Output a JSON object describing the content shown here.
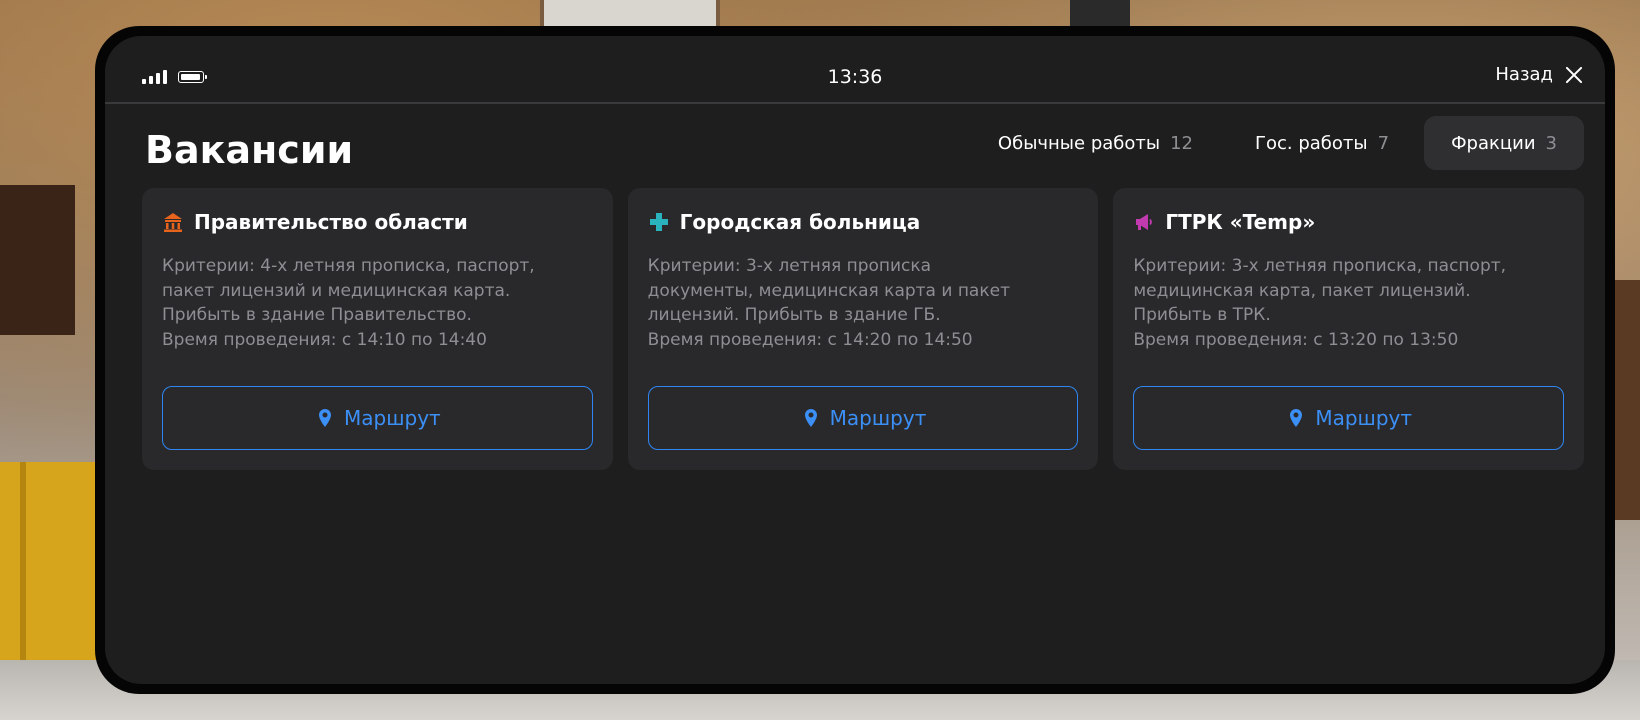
{
  "statusbar": {
    "time": "13:36",
    "back_label": "Назад"
  },
  "page": {
    "title": "Вакансии"
  },
  "tabs": [
    {
      "label": "Обычные работы",
      "count": "12",
      "active": false
    },
    {
      "label": "Гос. работы",
      "count": "7",
      "active": false
    },
    {
      "label": "Фракции",
      "count": "3",
      "active": true
    }
  ],
  "cards": [
    {
      "icon": "government-building-icon",
      "icon_color": "#e8631c",
      "title": "Правительство области",
      "lines": [
        "Критерии: 4-х летняя прописка, паспорт,",
        "пакет лицензий и медицинская карта.",
        "Прибыть в здание Правительство.",
        "Время проведения: с 14:10 по 14:40"
      ],
      "button_label": "Маршрут"
    },
    {
      "icon": "medical-cross-icon",
      "icon_color": "#2bb3bd",
      "title": "Городская больница",
      "lines": [
        "Критерии: 3-х летняя прописка",
        "документы, медицинская карта и пакет",
        "лицензий. Прибыть в здание ГБ.",
        "Время проведения: с 14:20 по 14:50"
      ],
      "button_label": "Маршрут"
    },
    {
      "icon": "megaphone-icon",
      "icon_color": "#c23ab0",
      "title": "ГТРК «Temp»",
      "lines": [
        "Критерии: 3-х летняя прописка, паспорт,",
        "медицинская карта, пакет лицензий.",
        "Прибыть в ТРК.",
        "Время проведения: с 13:20 по 13:50"
      ],
      "button_label": "Маршрут"
    }
  ],
  "colors": {
    "accent": "#2f86f0",
    "background": "#1e1e1f",
    "card": "#29292c",
    "muted": "#8e8e93"
  }
}
